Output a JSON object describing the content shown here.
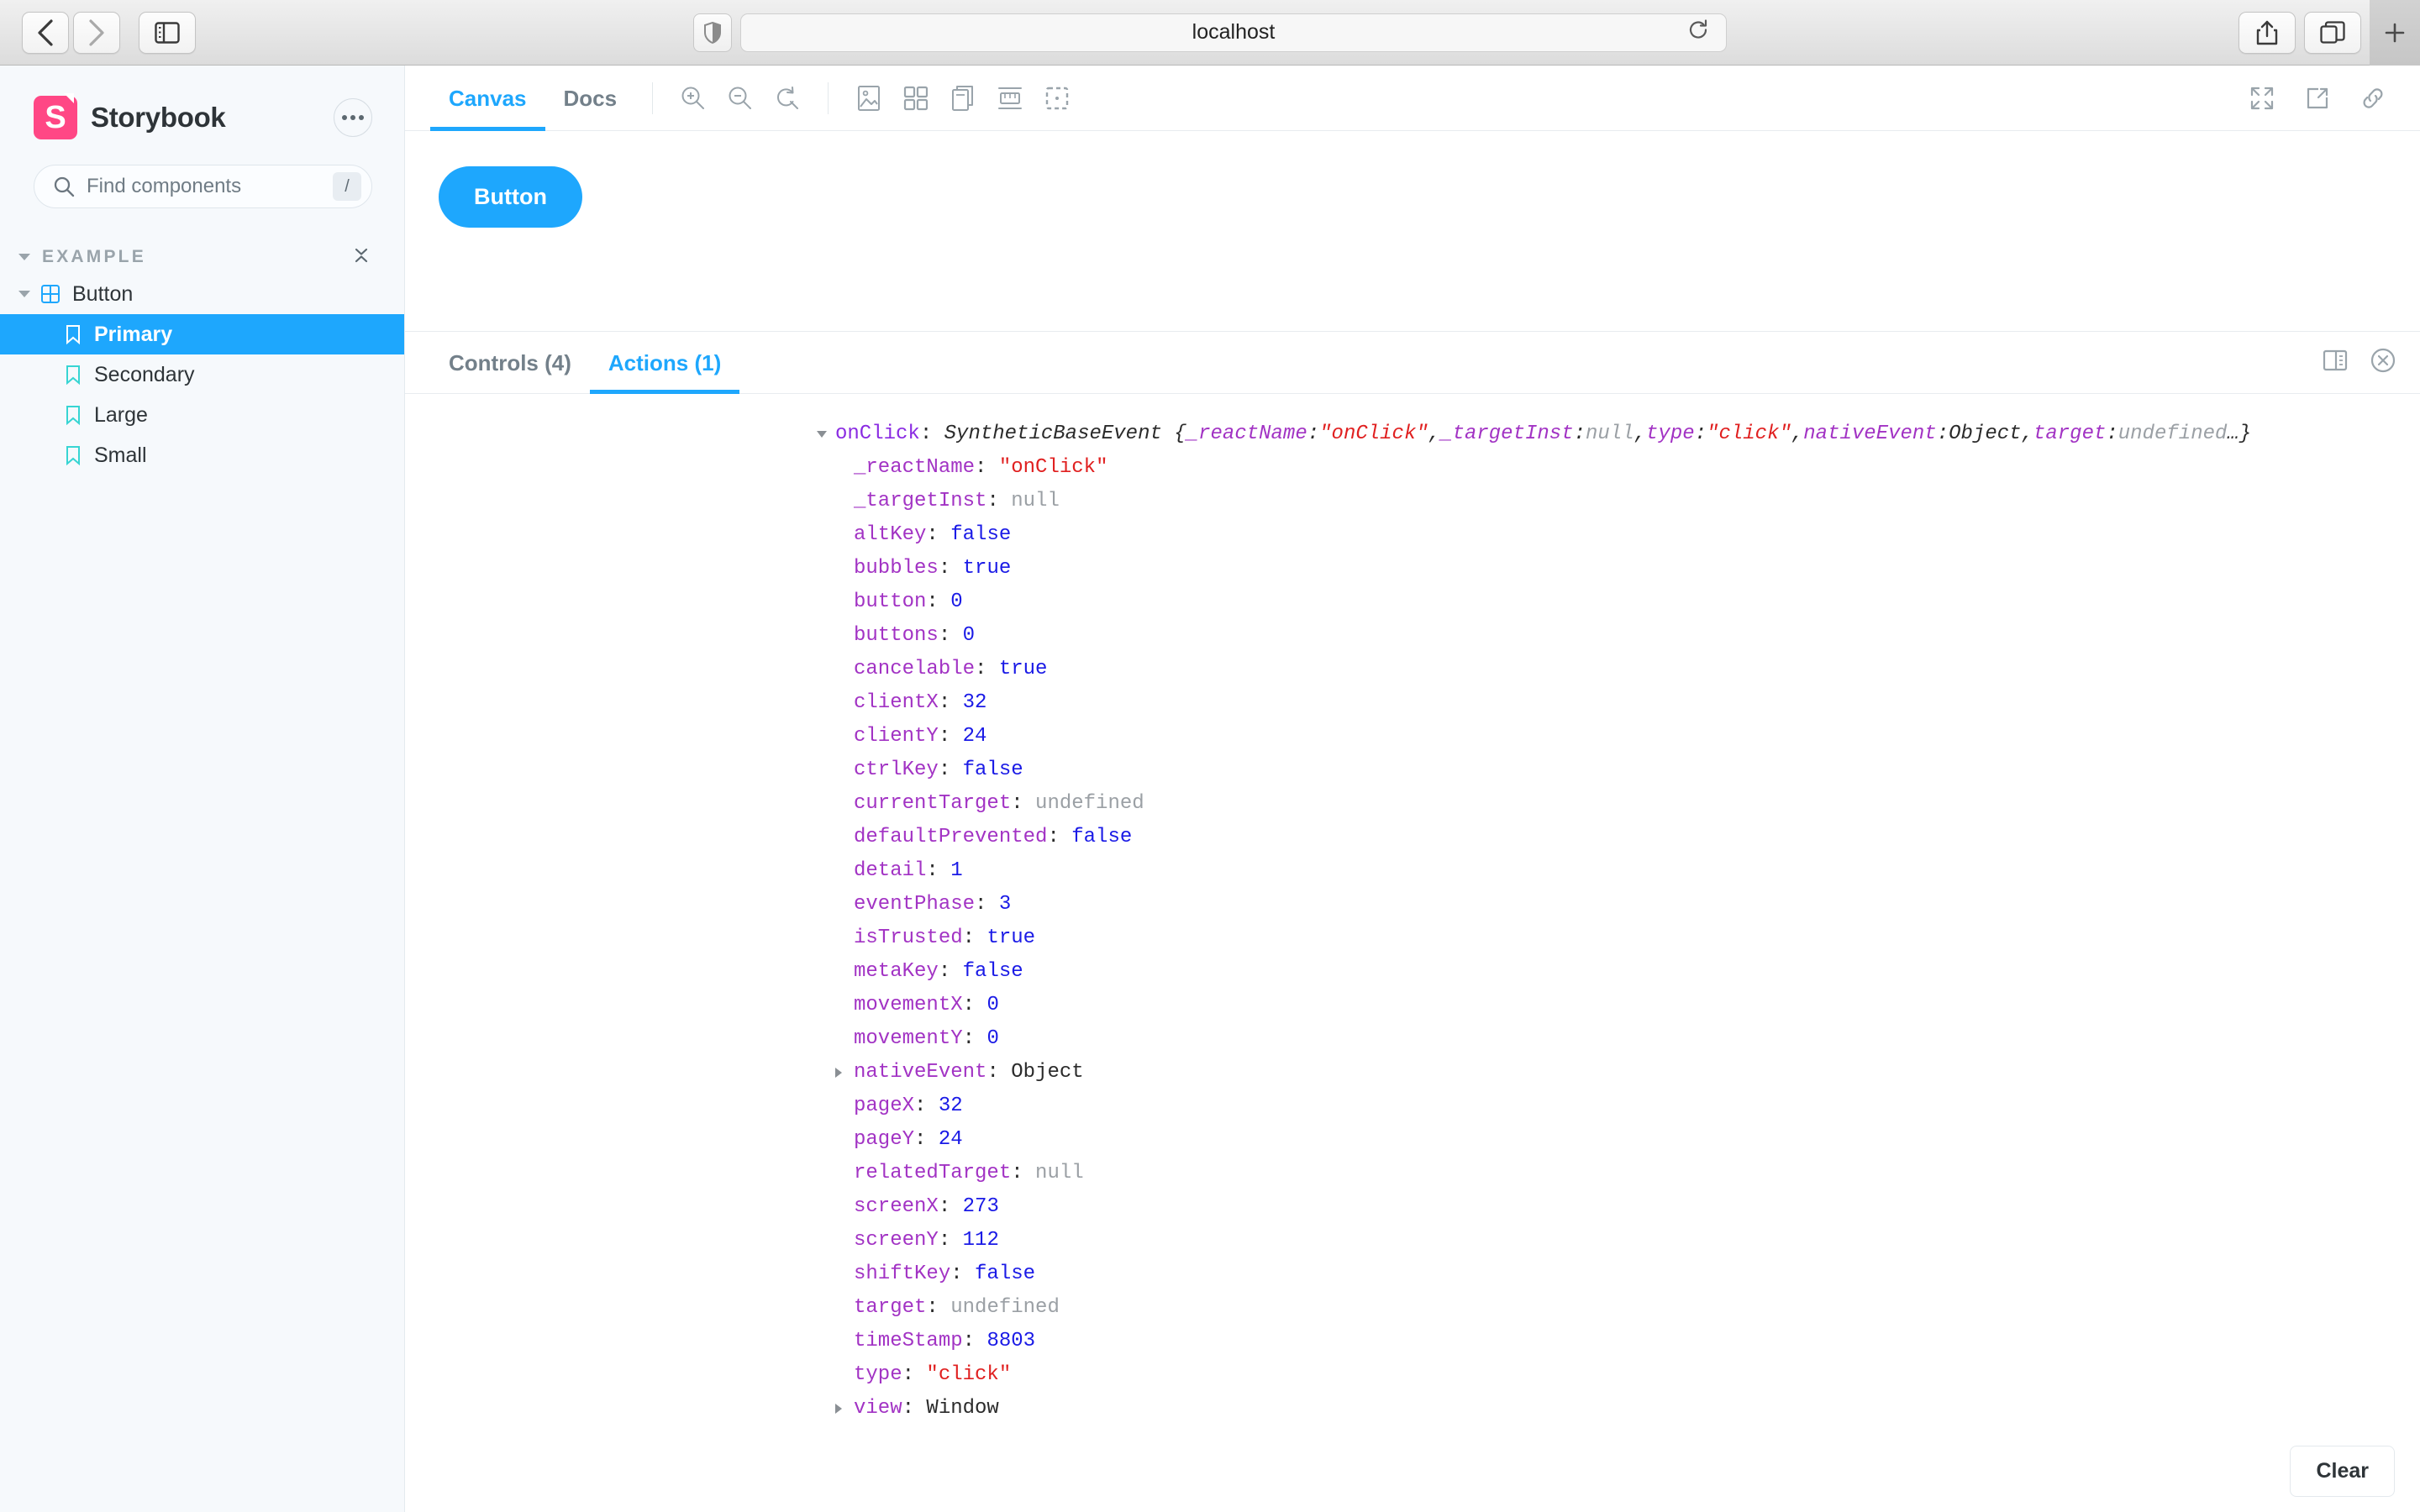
{
  "browser": {
    "back_label": "Back",
    "forward_label": "Forward",
    "sidebar_toggle_label": "Show Sidebar",
    "privacy_label": "Privacy Report",
    "url": "localhost",
    "reload_label": "Reload",
    "share_label": "Share",
    "tabs_label": "Tab Overview",
    "newtab_label": "New Tab"
  },
  "sidebar": {
    "brand": "Storybook",
    "logo_letter": "S",
    "menu_label": "More",
    "search": {
      "placeholder": "Find components",
      "shortcut": "/"
    },
    "group": {
      "label": "EXAMPLE",
      "collapse_all_label": "Collapse all"
    },
    "component": {
      "label": "Button",
      "icon": "component-icon"
    },
    "stories": [
      {
        "label": "Primary",
        "selected": true
      },
      {
        "label": "Secondary",
        "selected": false
      },
      {
        "label": "Large",
        "selected": false
      },
      {
        "label": "Small",
        "selected": false
      }
    ]
  },
  "toolbar": {
    "tabs": [
      {
        "label": "Canvas",
        "active": true
      },
      {
        "label": "Docs",
        "active": false
      }
    ],
    "icons": [
      "zoom-in-icon",
      "zoom-out-icon",
      "zoom-reset-icon",
      "backgrounds-icon",
      "grid-icon",
      "theme-icon",
      "measure-icon",
      "outline-icon"
    ],
    "right_icons": [
      "fullscreen-icon",
      "open-new-tab-icon",
      "copy-link-icon"
    ]
  },
  "canvas": {
    "button_label": "Button",
    "accent": "#1ea7fd"
  },
  "panel": {
    "tabs": [
      {
        "label": "Controls (4)",
        "active": false
      },
      {
        "label": "Actions (1)",
        "active": true
      }
    ],
    "right_icons": [
      "panel-position-icon",
      "close-panel-icon"
    ],
    "clear_label": "Clear"
  },
  "action_log": {
    "action_name": "onClick",
    "class_name": "SyntheticBaseEvent",
    "preview": {
      "open": "{",
      "items": [
        {
          "key": "_reactName",
          "value": "\"onClick\"",
          "type": "string"
        },
        {
          "key": "_targetInst",
          "value": "null",
          "type": "null"
        },
        {
          "key": "type",
          "value": "\"click\"",
          "type": "string"
        },
        {
          "key": "nativeEvent",
          "value": "Object",
          "type": "object"
        },
        {
          "key": "target",
          "value": "undefined",
          "type": "undefined"
        }
      ],
      "close": "…}"
    },
    "rows": [
      {
        "key": "_reactName",
        "value": "\"onClick\"",
        "type": "string",
        "expandable": false
      },
      {
        "key": "_targetInst",
        "value": "null",
        "type": "null",
        "expandable": false
      },
      {
        "key": "altKey",
        "value": "false",
        "type": "bool",
        "expandable": false
      },
      {
        "key": "bubbles",
        "value": "true",
        "type": "bool",
        "expandable": false
      },
      {
        "key": "button",
        "value": "0",
        "type": "num",
        "expandable": false
      },
      {
        "key": "buttons",
        "value": "0",
        "type": "num",
        "expandable": false
      },
      {
        "key": "cancelable",
        "value": "true",
        "type": "bool",
        "expandable": false
      },
      {
        "key": "clientX",
        "value": "32",
        "type": "num",
        "expandable": false
      },
      {
        "key": "clientY",
        "value": "24",
        "type": "num",
        "expandable": false
      },
      {
        "key": "ctrlKey",
        "value": "false",
        "type": "bool",
        "expandable": false
      },
      {
        "key": "currentTarget",
        "value": "undefined",
        "type": "undefined",
        "expandable": false
      },
      {
        "key": "defaultPrevented",
        "value": "false",
        "type": "bool",
        "expandable": false
      },
      {
        "key": "detail",
        "value": "1",
        "type": "num",
        "expandable": false
      },
      {
        "key": "eventPhase",
        "value": "3",
        "type": "num",
        "expandable": false
      },
      {
        "key": "isTrusted",
        "value": "true",
        "type": "bool",
        "expandable": false
      },
      {
        "key": "metaKey",
        "value": "false",
        "type": "bool",
        "expandable": false
      },
      {
        "key": "movementX",
        "value": "0",
        "type": "num",
        "expandable": false
      },
      {
        "key": "movementY",
        "value": "0",
        "type": "num",
        "expandable": false
      },
      {
        "key": "nativeEvent",
        "value": "Object",
        "type": "object",
        "expandable": true
      },
      {
        "key": "pageX",
        "value": "32",
        "type": "num",
        "expandable": false
      },
      {
        "key": "pageY",
        "value": "24",
        "type": "num",
        "expandable": false
      },
      {
        "key": "relatedTarget",
        "value": "null",
        "type": "null",
        "expandable": false
      },
      {
        "key": "screenX",
        "value": "273",
        "type": "num",
        "expandable": false
      },
      {
        "key": "screenY",
        "value": "112",
        "type": "num",
        "expandable": false
      },
      {
        "key": "shiftKey",
        "value": "false",
        "type": "bool",
        "expandable": false
      },
      {
        "key": "target",
        "value": "undefined",
        "type": "undefined",
        "expandable": false
      },
      {
        "key": "timeStamp",
        "value": "8803",
        "type": "num",
        "expandable": false
      },
      {
        "key": "type",
        "value": "\"click\"",
        "type": "string",
        "expandable": false
      },
      {
        "key": "view",
        "value": "Window",
        "type": "object",
        "expandable": true
      }
    ]
  }
}
